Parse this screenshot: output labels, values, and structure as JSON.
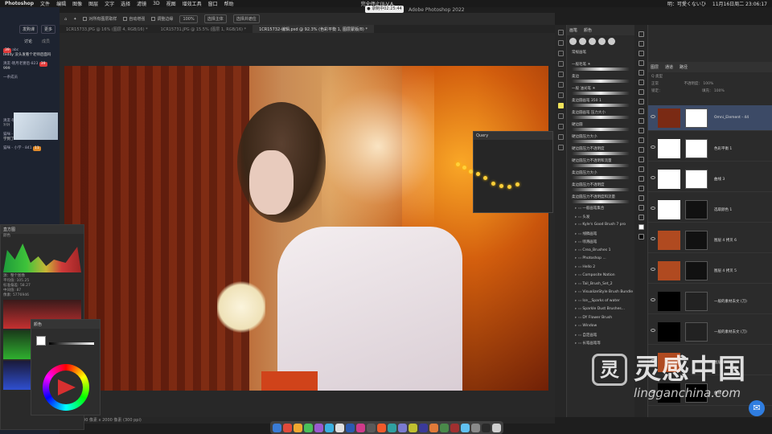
{
  "menubar": {
    "app": "Photoshop",
    "items": [
      "文件",
      "编辑",
      "图像",
      "图层",
      "文字",
      "选择",
      "滤镜",
      "3D",
      "视图",
      "增效工具",
      "窗口",
      "帮助"
    ],
    "center": "完全停止(Ⅱ-V.A.",
    "status_user": "明：可愛くないひ",
    "datetime": "11月16日周二 23:06:17"
  },
  "recording_badge": "● 录制中02:25:44",
  "window_title": "Adobe Photoshop 2022",
  "options_bar": {
    "items": [
      "对所有图层取样",
      "自动增强",
      "调整边缘",
      "100%",
      "选择主体",
      "选择并遮住"
    ]
  },
  "tabs": [
    {
      "label": "1CR15733.JPG @ 16% (图层 4, RGB/16) *"
    },
    {
      "label": "1CR15731.JPG @ 15.5% (图层 1, RGB/16) *"
    },
    {
      "label": "1CR15732-编辑.psd @ 92.3% (色彩平衡 1, 图层蒙版/8) *"
    }
  ],
  "status_bar": "92.83%   3000 像素 x 2000 像素 (300 ppi)",
  "chat": {
    "header_buttons": [
      "发购课",
      "更多"
    ],
    "tabs": [
      "讨论",
      "成员"
    ],
    "messages": [
      {
        "name": "abc",
        "badge": "39",
        "text": "teddy 没头发看个老师后面吗"
      },
      {
        "name": "清友-晓月老婆后-823",
        "badge": "39",
        "text": "999"
      },
      {
        "name": "一条成员",
        "badge": "",
        "text": ""
      },
      {
        "name": "清友-晓月老婆后-823",
        "badge": "39",
        "text": "?!?!"
      },
      {
        "name": "猫咪 - 小学 - 841",
        "badge": "11",
        "text": "学到了"
      },
      {
        "name": "猫咪 - 小学 - 841",
        "badge": "11",
        "text": ""
      }
    ]
  },
  "histogram": {
    "title": "直方图",
    "channel": "颜色",
    "source": "源：整个图像",
    "stats": [
      "平均值: 105.25",
      "标准偏差: 58.27",
      "中间值: 87",
      "像素: 5776946"
    ]
  },
  "color_panel": {
    "title": "颜色"
  },
  "brush_panel": {
    "tabs": [
      "画笔",
      "颜色"
    ],
    "groups": [
      "常规画笔",
      "一般毛笔 ☀",
      "柔边",
      "一般 油光笔 ☀",
      "柔边圆画笔 350 1",
      "柔边圆画笔 压力大小",
      "硬边圆",
      "硬边圆压力大小",
      "硬边圆压力不透明度",
      "硬边圆压力不透明和流量",
      "柔边圆压力大小",
      "柔边圆压力不透明度",
      "柔边圆压力不透明度和流量"
    ],
    "folders": [
      "一般画笔集合",
      "头发",
      "Kyle's Good Brush 7 pro",
      "线稿画笔",
      "喷溅画笔",
      "Crea_Brushes 1",
      "Photoshop ...",
      "Hello 2",
      "Composite Nation",
      "Tail_Brush_Set_2",
      "VisualizeStyle Brush Bundle",
      "Ice__Sparks of water",
      "Sparkle Dust Brushes...",
      "DY Flower Brush",
      "Window",
      "自定画笔",
      "长笔画笔等"
    ]
  },
  "query_panel": {
    "title": "Query"
  },
  "layers": {
    "tabs": [
      "图层",
      "通道",
      "路径"
    ],
    "kind_label": "Q 类型",
    "blend_mode": "正常",
    "opacity_label": "不透明度：",
    "opacity": "100%",
    "lock_label": "锁定：",
    "fill_label": "填充：",
    "fill": "100%",
    "items": [
      {
        "name": "Omni_Element - 44",
        "selected": true
      },
      {
        "name": "色彩平衡 1",
        "selected": false
      },
      {
        "name": "曲线 3",
        "selected": false
      },
      {
        "name": "选取颜色 1",
        "selected": false
      },
      {
        "name": "图层 4 拷贝 6",
        "selected": false
      },
      {
        "name": "图层 4 拷贝 5",
        "selected": false
      },
      {
        "name": "一般的素材去文 (刀)",
        "selected": false
      },
      {
        "name": "一般的素材去文 (刀)",
        "selected": false
      },
      {
        "name": "图层 4",
        "selected": false
      },
      {
        "name": "曲线 2",
        "selected": false
      }
    ]
  },
  "watermark": {
    "logo_glyph": "灵",
    "cn": "灵感中国",
    "url": "lingganchina.com"
  },
  "colors": {
    "accent": "#2f7de0",
    "ps_bg": "#282828",
    "panel": "#2b2b2b",
    "selection": "#3c4a66",
    "badge_red": "#e03b3b"
  }
}
